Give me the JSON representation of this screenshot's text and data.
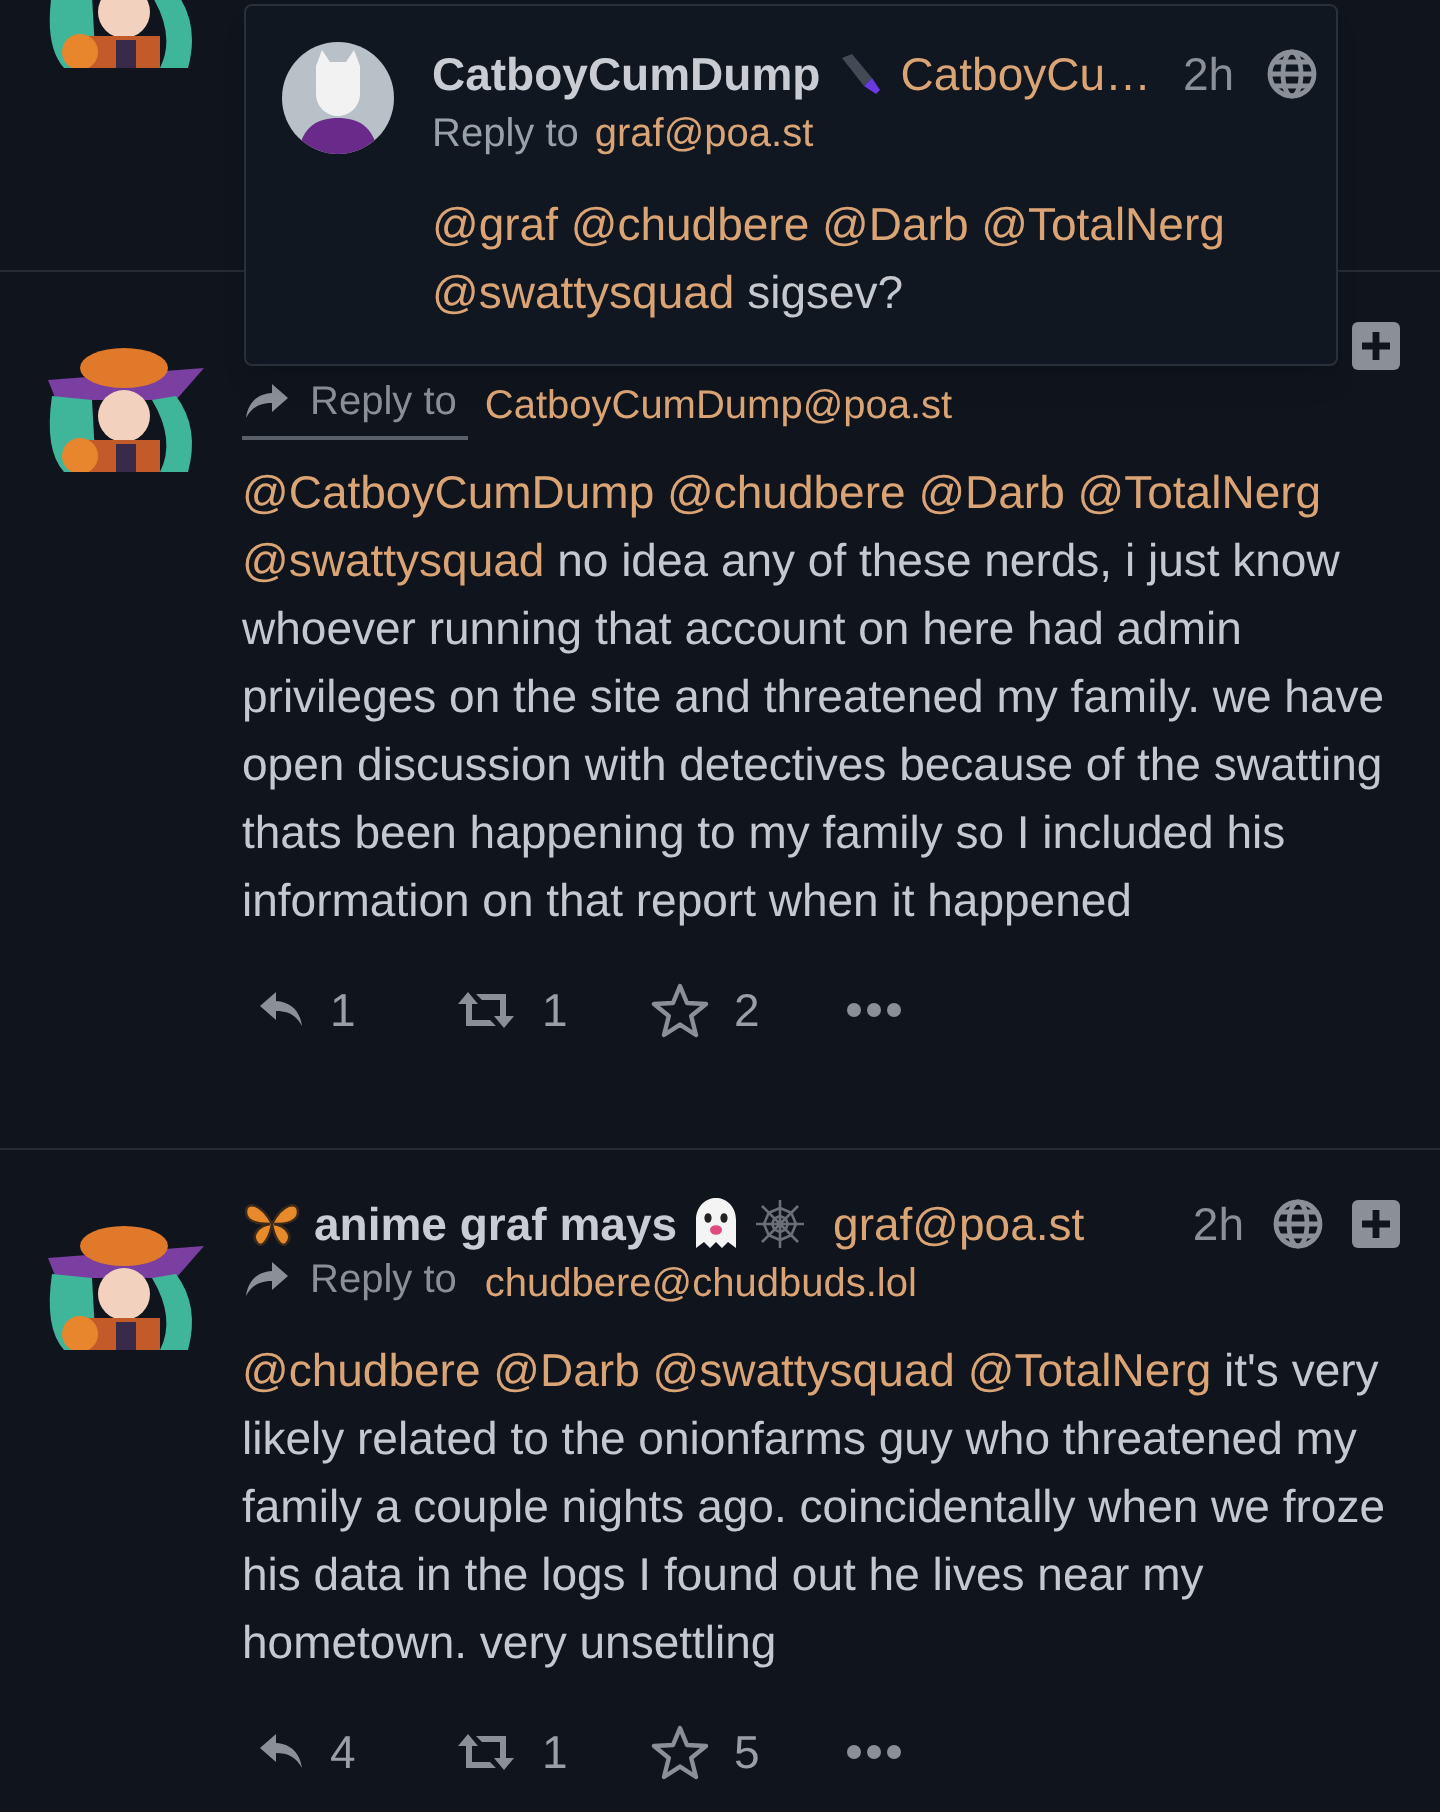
{
  "popup": {
    "name": "CatboyCumDump",
    "handle": "CatboyCu…",
    "time": "2h",
    "reply_label": "Reply to",
    "reply_to": "graf@poa.st",
    "body": [
      {
        "kind": "mention",
        "text": "@graf"
      },
      {
        "kind": "mention",
        "text": "@chudbere"
      },
      {
        "kind": "mention",
        "text": "@Darb"
      },
      {
        "kind": "mention",
        "text": "@TotalNerg"
      },
      {
        "kind": "mention",
        "text": "@swattysquad"
      },
      {
        "kind": "text",
        "text": "sigsev?"
      }
    ]
  },
  "posts": [
    {
      "reply_label": "Reply to",
      "reply_to": "CatboyCumDump@poa.st",
      "reply_hovered": true,
      "body": [
        {
          "kind": "mention",
          "text": "@CatboyCumDump"
        },
        {
          "kind": "mention",
          "text": "@chudbere"
        },
        {
          "kind": "mention",
          "text": "@Darb"
        },
        {
          "kind": "mention",
          "text": "@TotalNerg"
        },
        {
          "kind": "mention",
          "text": "@swattysquad"
        },
        {
          "kind": "text",
          "text": "no idea any of these nerds, i just know whoever running that account on here had admin privileges on the site and threatened my family. we have open discussion with detectives because of the swatting thats been happening to my family so I included his information on that report when it happened"
        }
      ],
      "actions": [
        {
          "kind": "reply",
          "count": "1"
        },
        {
          "kind": "boost",
          "count": "1"
        },
        {
          "kind": "favorite",
          "count": "2"
        },
        {
          "kind": "more"
        }
      ]
    },
    {
      "name": "anime graf mays",
      "handle": "graf@poa.st",
      "time": "2h",
      "reply_label": "Reply to",
      "reply_to": "chudbere@chudbuds.lol",
      "reply_hovered": false,
      "body": [
        {
          "kind": "mention",
          "text": "@chudbere"
        },
        {
          "kind": "mention",
          "text": "@Darb"
        },
        {
          "kind": "mention",
          "text": "@swattysquad"
        },
        {
          "kind": "mention",
          "text": "@TotalNerg"
        },
        {
          "kind": "text",
          "text": "it's very likely related to the onionfarms guy who threatened my family a couple nights ago. coincidentally when we froze his data in the logs I found out he lives near my hometown. very unsettling"
        }
      ],
      "actions": [
        {
          "kind": "reply",
          "count": "4"
        },
        {
          "kind": "boost",
          "count": "1"
        },
        {
          "kind": "favorite",
          "count": "5"
        },
        {
          "kind": "more"
        }
      ]
    }
  ]
}
